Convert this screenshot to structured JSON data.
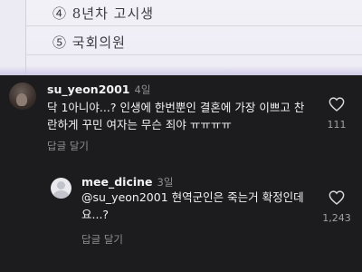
{
  "post_image": {
    "options": [
      "④ 8년차 고시생",
      "⑤ 국회의원"
    ]
  },
  "comments": [
    {
      "username": "su_yeon2001",
      "time": "4일",
      "text": "닥 1아니야...? 인생에 한번뿐인 결혼에 가장 이쁘고 찬란하게 꾸민 여자는 무슨 죄야 ㅠㅠㅠㅠ",
      "reply_label": "답글 달기",
      "likes": "111",
      "avatar_icon": "profile-photo"
    },
    {
      "username": "mee_dicine",
      "time": "3일",
      "text": "@su_yeon2001 현역군인은 죽는거 확정인데요...?",
      "reply_label": "답글 달기",
      "likes": "1,243",
      "avatar_icon": "default-profile-icon"
    }
  ],
  "colors": {
    "background": "#1c1c1e",
    "text_primary": "#f2f2f2",
    "text_secondary": "#8e8e93"
  }
}
